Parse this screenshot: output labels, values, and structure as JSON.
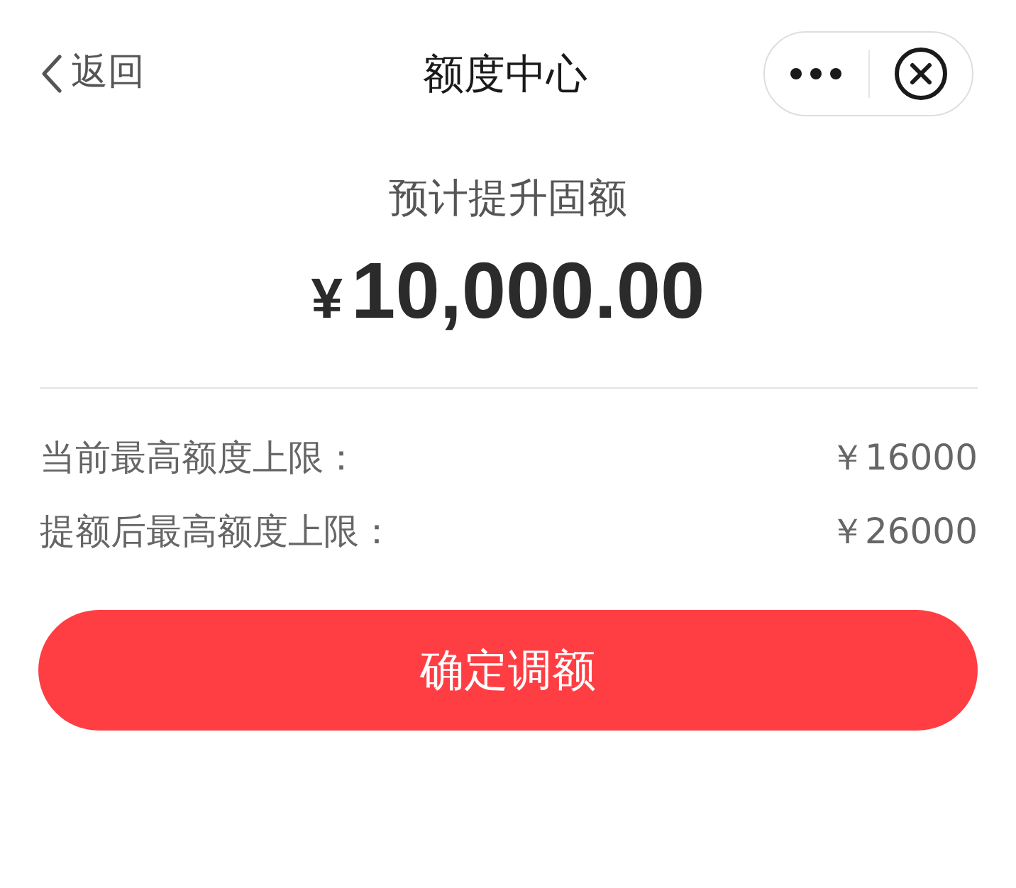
{
  "nav_bar": {
    "back_label": "返回",
    "title": "额度中心"
  },
  "estimate": {
    "label": "预计提升固额",
    "currency": "¥",
    "amount": "10,000.00"
  },
  "limits": [
    {
      "label": "当前最高额度上限：",
      "value": "￥16000"
    },
    {
      "label": "提额后最高额度上限：",
      "value": "￥26000"
    }
  ],
  "confirm_button": "确定调额"
}
